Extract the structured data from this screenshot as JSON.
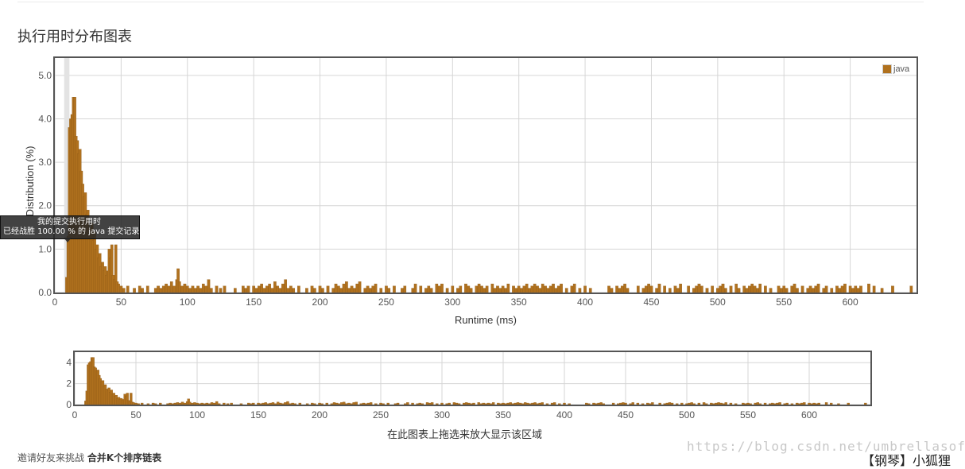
{
  "page": {
    "title": "执行用时分布图表",
    "overview_caption": "在此图表上拖选来放大显示该区域",
    "footer_prefix": "邀请好友来挑战",
    "footer_link": "合并K个排序链表",
    "watermark": "https://blog.csdn.net/umbrellasoft",
    "corner_stamp": "【钢琴】小狐狸"
  },
  "tooltip": {
    "line1": "我的提交执行用时",
    "line2": "已经战胜 100.00 % 的 java 提交记录"
  },
  "colors": {
    "bar": "#b0711e",
    "highlight": "#e3e3e3"
  },
  "chart_data": [
    {
      "type": "bar",
      "name": "main",
      "xlabel": "Runtime (ms)",
      "ylabel": "Distribution (%)",
      "xlim": [
        0,
        650
      ],
      "ylim": [
        0,
        5.4
      ],
      "xticks": [
        0,
        50,
        100,
        150,
        200,
        250,
        300,
        350,
        400,
        450,
        500,
        550,
        600
      ],
      "yticks": [
        "0.0",
        "1.0",
        "2.0",
        "3.0",
        "4.0",
        "5.0"
      ],
      "grid": true,
      "legend": {
        "label": "java",
        "position": "top-right"
      },
      "highlight_range": [
        7,
        11
      ],
      "bar_width": 2,
      "series": [
        {
          "name": "java",
          "values": [
            [
              9,
              0.35
            ],
            [
              10,
              1.3
            ],
            [
              11,
              3.8
            ],
            [
              12,
              4.0
            ],
            [
              13,
              4.1
            ],
            [
              14,
              4.5
            ],
            [
              15,
              4.5
            ],
            [
              16,
              3.6
            ],
            [
              17,
              3.5
            ],
            [
              18,
              3.2
            ],
            [
              19,
              3.3
            ],
            [
              20,
              2.8
            ],
            [
              21,
              2.5
            ],
            [
              22,
              2.2
            ],
            [
              23,
              2.3
            ],
            [
              24,
              1.8
            ],
            [
              25,
              1.9
            ],
            [
              26,
              1.5
            ],
            [
              27,
              1.3
            ],
            [
              28,
              1.6
            ],
            [
              29,
              1.2
            ],
            [
              30,
              1.4
            ],
            [
              31,
              1.0
            ],
            [
              32,
              1.1
            ],
            [
              33,
              0.8
            ],
            [
              34,
              0.9
            ],
            [
              35,
              0.6
            ],
            [
              36,
              0.7
            ],
            [
              37,
              0.5
            ],
            [
              38,
              0.6
            ],
            [
              39,
              0.4
            ],
            [
              40,
              0.5
            ],
            [
              41,
              1.0
            ],
            [
              42,
              0.8
            ],
            [
              43,
              1.1
            ],
            [
              44,
              0.4
            ],
            [
              45,
              0.3
            ],
            [
              46,
              1.1
            ],
            [
              47,
              0.25
            ],
            [
              48,
              0.2
            ],
            [
              50,
              0.15
            ],
            [
              52,
              0.1
            ],
            [
              55,
              0.15
            ],
            [
              60,
              0.1
            ],
            [
              64,
              0.15
            ],
            [
              66,
              0.1
            ],
            [
              70,
              0.15
            ],
            [
              76,
              0.1
            ],
            [
              78,
              0.15
            ],
            [
              80,
              0.1
            ],
            [
              82,
              0.15
            ],
            [
              84,
              0.2
            ],
            [
              86,
              0.15
            ],
            [
              88,
              0.25
            ],
            [
              90,
              0.15
            ],
            [
              92,
              0.3
            ],
            [
              93,
              0.55
            ],
            [
              94,
              0.25
            ],
            [
              96,
              0.15
            ],
            [
              98,
              0.2
            ],
            [
              100,
              0.15
            ],
            [
              102,
              0.1
            ],
            [
              104,
              0.15
            ],
            [
              106,
              0.1
            ],
            [
              108,
              0.15
            ],
            [
              110,
              0.1
            ],
            [
              112,
              0.2
            ],
            [
              114,
              0.15
            ],
            [
              116,
              0.3
            ],
            [
              118,
              0.1
            ],
            [
              122,
              0.15
            ],
            [
              125,
              0.1
            ],
            [
              128,
              0.15
            ],
            [
              136,
              0.1
            ],
            [
              142,
              0.15
            ],
            [
              144,
              0.1
            ],
            [
              146,
              0.15
            ],
            [
              150,
              0.15
            ],
            [
              152,
              0.1
            ],
            [
              154,
              0.15
            ],
            [
              156,
              0.2
            ],
            [
              158,
              0.1
            ],
            [
              160,
              0.15
            ],
            [
              162,
              0.2
            ],
            [
              164,
              0.1
            ],
            [
              166,
              0.25
            ],
            [
              168,
              0.15
            ],
            [
              170,
              0.1
            ],
            [
              172,
              0.2
            ],
            [
              174,
              0.3
            ],
            [
              176,
              0.1
            ],
            [
              178,
              0.15
            ],
            [
              180,
              0.1
            ],
            [
              184,
              0.15
            ],
            [
              190,
              0.1
            ],
            [
              194,
              0.15
            ],
            [
              196,
              0.1
            ],
            [
              200,
              0.15
            ],
            [
              202,
              0.1
            ],
            [
              206,
              0.15
            ],
            [
              210,
              0.1
            ],
            [
              212,
              0.2
            ],
            [
              214,
              0.15
            ],
            [
              216,
              0.1
            ],
            [
              218,
              0.2
            ],
            [
              220,
              0.25
            ],
            [
              222,
              0.1
            ],
            [
              224,
              0.15
            ],
            [
              226,
              0.1
            ],
            [
              228,
              0.2
            ],
            [
              230,
              0.25
            ],
            [
              234,
              0.1
            ],
            [
              236,
              0.15
            ],
            [
              238,
              0.1
            ],
            [
              240,
              0.15
            ],
            [
              242,
              0.2
            ],
            [
              246,
              0.1
            ],
            [
              250,
              0.15
            ],
            [
              252,
              0.1
            ],
            [
              256,
              0.15
            ],
            [
              262,
              0.1
            ],
            [
              264,
              0.15
            ],
            [
              270,
              0.1
            ],
            [
              272,
              0.2
            ],
            [
              276,
              0.15
            ],
            [
              280,
              0.1
            ],
            [
              282,
              0.15
            ],
            [
              284,
              0.1
            ],
            [
              288,
              0.2
            ],
            [
              290,
              0.15
            ],
            [
              292,
              0.2
            ],
            [
              296,
              0.1
            ],
            [
              300,
              0.15
            ],
            [
              304,
              0.1
            ],
            [
              306,
              0.15
            ],
            [
              310,
              0.2
            ],
            [
              312,
              0.15
            ],
            [
              314,
              0.1
            ],
            [
              318,
              0.15
            ],
            [
              320,
              0.2
            ],
            [
              322,
              0.15
            ],
            [
              324,
              0.1
            ],
            [
              326,
              0.15
            ],
            [
              330,
              0.2
            ],
            [
              332,
              0.1
            ],
            [
              334,
              0.15
            ],
            [
              336,
              0.1
            ],
            [
              338,
              0.15
            ],
            [
              340,
              0.1
            ],
            [
              342,
              0.2
            ],
            [
              346,
              0.15
            ],
            [
              348,
              0.1
            ],
            [
              350,
              0.15
            ],
            [
              352,
              0.1
            ],
            [
              354,
              0.15
            ],
            [
              356,
              0.2
            ],
            [
              358,
              0.1
            ],
            [
              360,
              0.15
            ],
            [
              362,
              0.2
            ],
            [
              364,
              0.15
            ],
            [
              366,
              0.1
            ],
            [
              368,
              0.2
            ],
            [
              370,
              0.15
            ],
            [
              372,
              0.1
            ],
            [
              374,
              0.15
            ],
            [
              376,
              0.2
            ],
            [
              378,
              0.1
            ],
            [
              380,
              0.15
            ],
            [
              382,
              0.2
            ],
            [
              386,
              0.1
            ],
            [
              390,
              0.15
            ],
            [
              392,
              0.2
            ],
            [
              396,
              0.1
            ],
            [
              400,
              0.15
            ],
            [
              404,
              0.1
            ],
            [
              418,
              0.15
            ],
            [
              420,
              0.1
            ],
            [
              424,
              0.15
            ],
            [
              426,
              0.1
            ],
            [
              428,
              0.15
            ],
            [
              430,
              0.2
            ],
            [
              432,
              0.1
            ],
            [
              440,
              0.15
            ],
            [
              444,
              0.1
            ],
            [
              446,
              0.15
            ],
            [
              448,
              0.2
            ],
            [
              450,
              0.15
            ],
            [
              454,
              0.1
            ],
            [
              456,
              0.2
            ],
            [
              460,
              0.15
            ],
            [
              464,
              0.1
            ],
            [
              468,
              0.15
            ],
            [
              470,
              0.1
            ],
            [
              472,
              0.2
            ],
            [
              478,
              0.15
            ],
            [
              482,
              0.1
            ],
            [
              484,
              0.15
            ],
            [
              486,
              0.2
            ],
            [
              488,
              0.15
            ],
            [
              492,
              0.1
            ],
            [
              496,
              0.15
            ],
            [
              500,
              0.1
            ],
            [
              502,
              0.15
            ],
            [
              504,
              0.2
            ],
            [
              506,
              0.1
            ],
            [
              510,
              0.15
            ],
            [
              514,
              0.2
            ],
            [
              516,
              0.1
            ],
            [
              520,
              0.15
            ],
            [
              522,
              0.1
            ],
            [
              524,
              0.15
            ],
            [
              526,
              0.2
            ],
            [
              528,
              0.15
            ],
            [
              530,
              0.1
            ],
            [
              532,
              0.2
            ],
            [
              536,
              0.15
            ],
            [
              540,
              0.1
            ],
            [
              546,
              0.15
            ],
            [
              548,
              0.1
            ],
            [
              550,
              0.15
            ],
            [
              552,
              0.1
            ],
            [
              556,
              0.15
            ],
            [
              558,
              0.2
            ],
            [
              560,
              0.1
            ],
            [
              564,
              0.15
            ],
            [
              568,
              0.1
            ],
            [
              570,
              0.15
            ],
            [
              572,
              0.1
            ],
            [
              574,
              0.15
            ],
            [
              576,
              0.2
            ],
            [
              580,
              0.1
            ],
            [
              582,
              0.15
            ],
            [
              586,
              0.1
            ],
            [
              590,
              0.15
            ],
            [
              592,
              0.1
            ],
            [
              594,
              0.15
            ],
            [
              596,
              0.2
            ],
            [
              600,
              0.15
            ],
            [
              602,
              0.1
            ],
            [
              604,
              0.15
            ],
            [
              606,
              0.1
            ],
            [
              608,
              0.15
            ],
            [
              614,
              0.2
            ],
            [
              618,
              0.15
            ],
            [
              624,
              0.1
            ],
            [
              632,
              0.15
            ],
            [
              646,
              0.15
            ]
          ]
        }
      ]
    },
    {
      "type": "bar",
      "name": "overview",
      "xlim": [
        0,
        650
      ],
      "ylim": [
        0,
        5
      ],
      "xticks": [
        0,
        50,
        100,
        150,
        200,
        250,
        300,
        350,
        400,
        450,
        500,
        550,
        600
      ],
      "yticks": [
        "0",
        "2",
        "4"
      ],
      "grid": true,
      "series_ref": "java"
    }
  ]
}
